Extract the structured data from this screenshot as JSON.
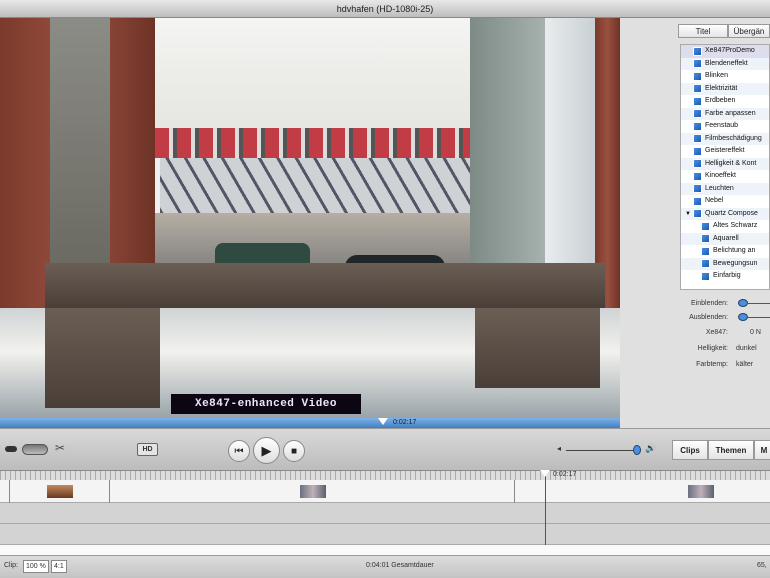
{
  "window": {
    "title": "hdvhafen (HD-1080i-25)"
  },
  "video": {
    "caption": "Xe847-enhanced Video",
    "playhead_time": "0:02:17"
  },
  "panel": {
    "tabs": [
      "Titel",
      "Übergän"
    ],
    "effects": [
      "Xe847ProDemo",
      "Blendeneffekt",
      "Blinken",
      "Elektrizität",
      "Erdbeben",
      "Farbe anpassen",
      "Feenstaub",
      "Filmbeschädigung",
      "Geistereffekt",
      "Helligkeit & Kont",
      "Kinoeffekt",
      "Leuchten",
      "Nebel"
    ],
    "group": "Quartz Compose",
    "group_items": [
      "Altes Schwarz",
      "Aquarell",
      "Belichtung an",
      "Bewegungsun",
      "Einfarbig"
    ],
    "params": [
      {
        "label": "Einblenden:",
        "type": "slider"
      },
      {
        "label": "Ausblenden:",
        "type": "slider"
      },
      {
        "label": "Xe847:",
        "value": "0 N"
      },
      {
        "label": "Helligkeit:",
        "value": "dunkel"
      },
      {
        "label": "Farbtemp:",
        "value": "kälter"
      }
    ]
  },
  "controls": {
    "hd": "HD",
    "tabs": [
      "Clips",
      "Themen",
      "M"
    ]
  },
  "timeline": {
    "playhead_time": "0:02:17"
  },
  "status": {
    "clip_label": "Clip:",
    "zoom": "100 %",
    "zoom2": "4:1",
    "duration": "0:04:01 Gesamtdauer",
    "size": "65,"
  }
}
